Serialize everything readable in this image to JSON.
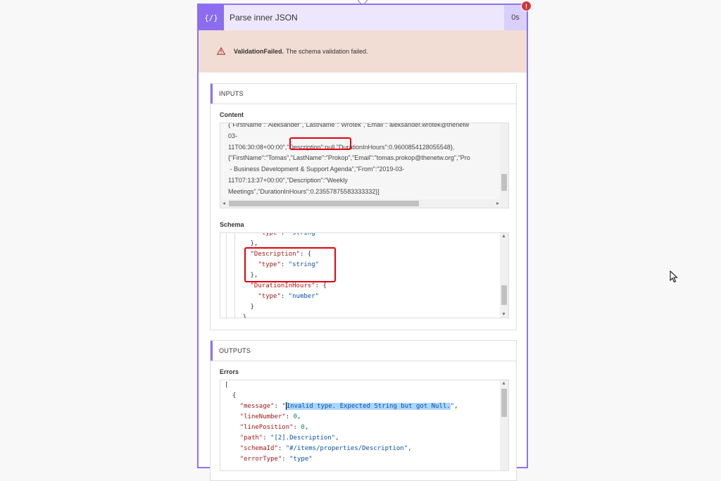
{
  "action": {
    "icon": "curly-braces-icon",
    "icon_glyph": "{∕}",
    "title": "Parse inner JSON",
    "duration": "0s",
    "error_badge": "!"
  },
  "banner": {
    "icon": "warning-triangle-icon",
    "status": "ValidationFailed.",
    "message": "The schema validation failed."
  },
  "inputs": {
    "heading": "INPUTS",
    "content_label": "Content",
    "content_lines": [
      "{\"FirstName\":\"Aleksander\",\"LastName\":\"Wrotek\",\"Email\":\"aleksander.wrotek@thenetw",
      "03-",
      "11T06:30:08+00:00\",\"Description\":null,\"DurationInHours\":0.9600854128055548},",
      "{\"FirstName\":\"Tomas\",\"LastName\":\"Prokop\",\"Email\":\"tomas.prokop@thenetw.org\",\"Pro",
      " - Business Development & Support Agenda\",\"From\":\"2019-03-",
      "11T07:13:37+00:00\",\"Description\":\"Weekly",
      "Meetings\",\"DurationInHours\":0.23557875583333332}]"
    ],
    "schema_label": "Schema",
    "schema": {
      "type_key": "\"type\"",
      "string_val": "\"string\"",
      "number_val": "\"number\"",
      "description_key": "\"Description\"",
      "duration_key": "\"DurationInHours\""
    }
  },
  "outputs": {
    "heading": "OUTPUTS",
    "errors_label": "Errors",
    "errors": {
      "message_key": "\"message\"",
      "message_val": "Invalid type. Expected String but got Null.",
      "linenumber_key": "\"lineNumber\"",
      "linenumber_val": "0",
      "lineposition_key": "\"linePosition\"",
      "lineposition_val": "0",
      "path_key": "\"path\"",
      "path_val": "\"[2].Description\"",
      "schemaid_key": "\"schemaId\"",
      "schemaid_val": "\"#/items/properties/Description\"",
      "errortype_key": "\"errorType\"",
      "errortype_val": "\"type\""
    }
  },
  "colors": {
    "accent": "#8f72ee",
    "header_bg": "#ede7fd",
    "banner_bg": "#f1ddd3",
    "error_red": "#d13438",
    "highlight_box": "#e3000f",
    "selection": "#add6ff"
  }
}
